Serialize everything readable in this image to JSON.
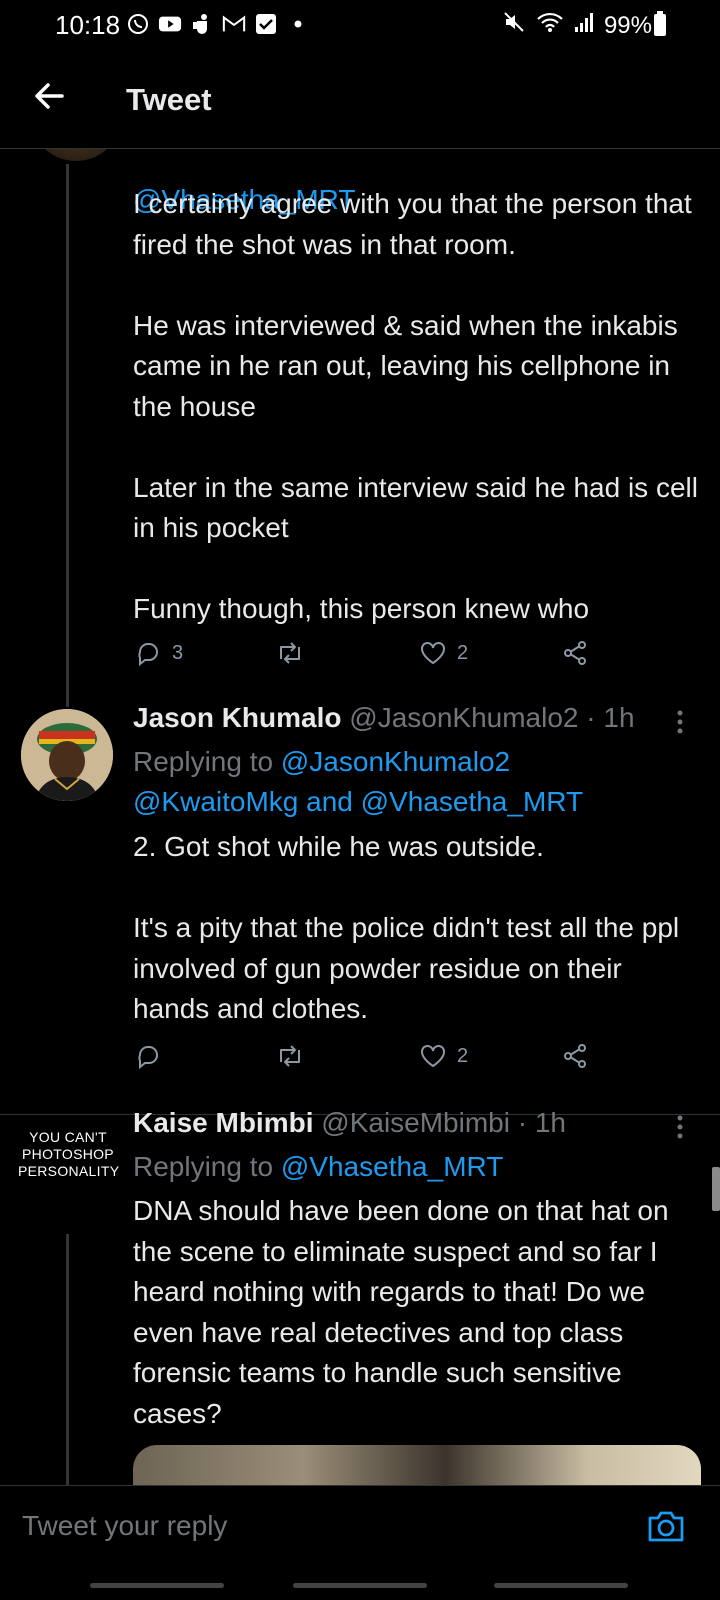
{
  "status_bar": {
    "time": "10:18",
    "battery": "99%",
    "icons": [
      "whatsapp-icon",
      "youtube-icon",
      "teams-icon",
      "gmail-icon",
      "check-icon",
      "dot-icon",
      "mute-icon",
      "wifi-icon",
      "signal-icon",
      "battery-icon"
    ]
  },
  "header": {
    "title": "Tweet"
  },
  "tweets": [
    {
      "mention_top": "@Vhasetha_MRT",
      "text": "I certainly agree with you that the person that fired the shot was in that room.\n\nHe was interviewed & said when the inkabis came in he ran out, leaving his cellphone in the house\n\nLater in the same interview said he had is cell in his pocket\n\nFunny though, this person knew who",
      "replies": "3",
      "retweets": "",
      "likes": "2"
    },
    {
      "name": "Jason Khumalo",
      "handle": "@JasonKhumalo2 · 1h",
      "replying_prefix": "Replying to ",
      "replying_mention1": "@JasonKhumalo2",
      "replying_line2": "@KwaitoMkg and @Vhasetha_MRT",
      "text": "2. Got shot while he was outside.\n\nIt's a pity that the police didn't test all the ppl involved of gun powder residue on their hands and clothes.",
      "replies": "",
      "retweets": "",
      "likes": "2"
    },
    {
      "name": "Kaise Mbimbi",
      "handle": "@KaiseMbimbi · 1h",
      "avatar_text": "YOU CAN'T\nPHOTOSHOP\nPERSONALITY",
      "replying_prefix": "Replying to ",
      "replying_mention1": "@Vhasetha_MRT",
      "text": "DNA should have been done on that hat on the scene to eliminate suspect and so far I heard nothing with regards to that! Do we even have real detectives and top class forensic teams to handle such sensitive cases?"
    }
  ],
  "reply_bar": {
    "placeholder": "Tweet your reply"
  },
  "colors": {
    "accent": "#1d9bf0",
    "background": "#000000",
    "text": "#e7e9ea",
    "muted": "#71767b"
  }
}
